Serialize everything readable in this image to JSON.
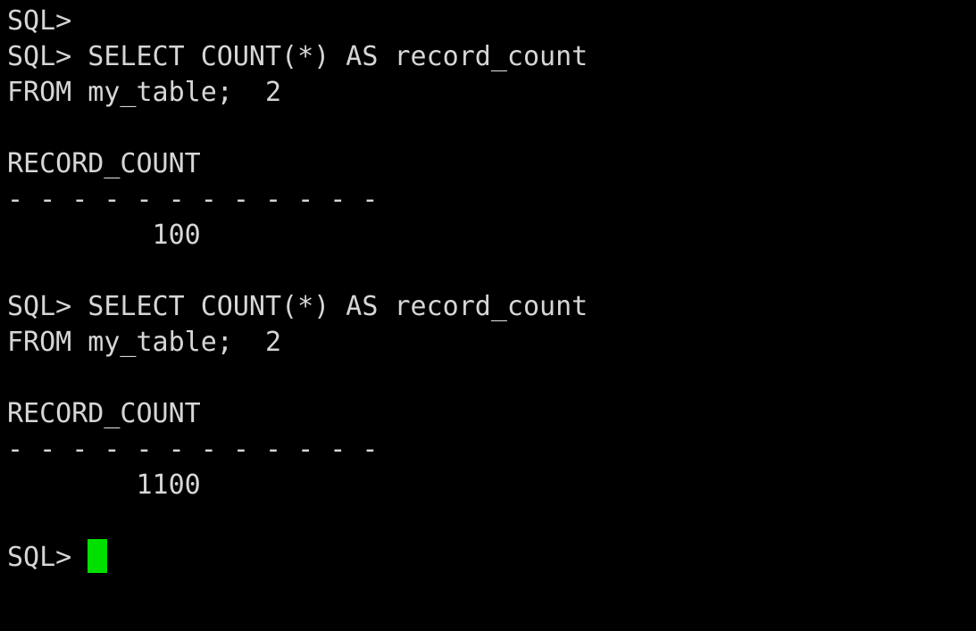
{
  "terminal": {
    "app": "sql-plus-console",
    "background_color": "#000000",
    "foreground_color": "#d6d6d6",
    "cursor_color": "#00e000",
    "cursor_style": "block",
    "columns": 58,
    "rows": 17,
    "prompt": "SQL>",
    "lines": [
      {
        "id": "line-1",
        "text": "SQL>",
        "kind": "prompt"
      },
      {
        "id": "line-2",
        "text": "SQL> SELECT COUNT(*) AS record_count",
        "kind": "prompt-command"
      },
      {
        "id": "line-3",
        "text": "FROM my_table;  2",
        "kind": "continuation"
      },
      {
        "id": "line-4",
        "text": "",
        "kind": "blank"
      },
      {
        "id": "line-5",
        "text": "RECORD_COUNT",
        "kind": "column-header"
      },
      {
        "id": "line-6",
        "text": "- - - - - - - - - - - -",
        "kind": "separator"
      },
      {
        "id": "line-7",
        "text": "         100",
        "kind": "result-value"
      },
      {
        "id": "line-8",
        "text": "",
        "kind": "blank"
      },
      {
        "id": "line-9",
        "text": "SQL> SELECT COUNT(*) AS record_count",
        "kind": "prompt-command"
      },
      {
        "id": "line-10",
        "text": "FROM my_table;  2",
        "kind": "continuation"
      },
      {
        "id": "line-11",
        "text": "",
        "kind": "blank"
      },
      {
        "id": "line-12",
        "text": "RECORD_COUNT",
        "kind": "column-header"
      },
      {
        "id": "line-13",
        "text": "- - - - - - - - - - - -",
        "kind": "separator"
      },
      {
        "id": "line-14",
        "text": "        1100",
        "kind": "result-value"
      },
      {
        "id": "line-15",
        "text": "",
        "kind": "blank"
      },
      {
        "id": "line-16",
        "text": "SQL> ",
        "kind": "prompt-cursor"
      }
    ]
  },
  "session_data": {
    "statements": [
      {
        "sql": "SELECT COUNT(*) AS record_count FROM my_table;",
        "continuation_marker": "2",
        "result_column": "RECORD_COUNT",
        "result_value": "100"
      },
      {
        "sql": "SELECT COUNT(*) AS record_count FROM my_table;",
        "continuation_marker": "2",
        "result_column": "RECORD_COUNT",
        "result_value": "1100"
      }
    ]
  }
}
